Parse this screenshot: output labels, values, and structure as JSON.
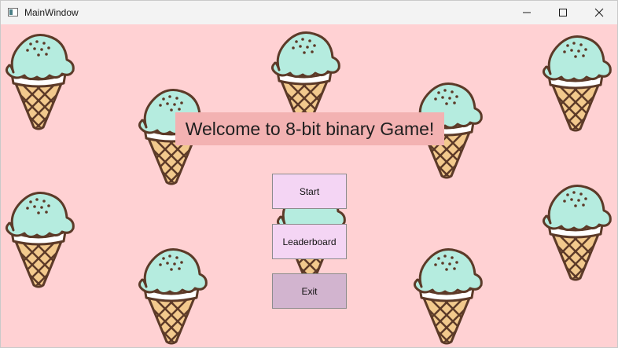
{
  "window": {
    "title": "MainWindow",
    "icon": "app-window-icon",
    "controls": [
      "minimize-icon",
      "maximize-icon",
      "close-icon"
    ]
  },
  "background": {
    "color": "#ffd1d3",
    "pattern_icon": "ice-cream-cone-icon"
  },
  "welcome": {
    "text": "Welcome to 8-bit binary Game!",
    "bg": "#f3b2b2"
  },
  "menu": {
    "start_label": "Start",
    "leaderboard_label": "Leaderboard",
    "exit_label": "Exit"
  },
  "colors": {
    "scoop": "#b5ecdf",
    "cone": "#f2c98d",
    "outline": "#5c3a28",
    "button": "#f4d5f4",
    "exit_button": "#d2b4cf"
  }
}
